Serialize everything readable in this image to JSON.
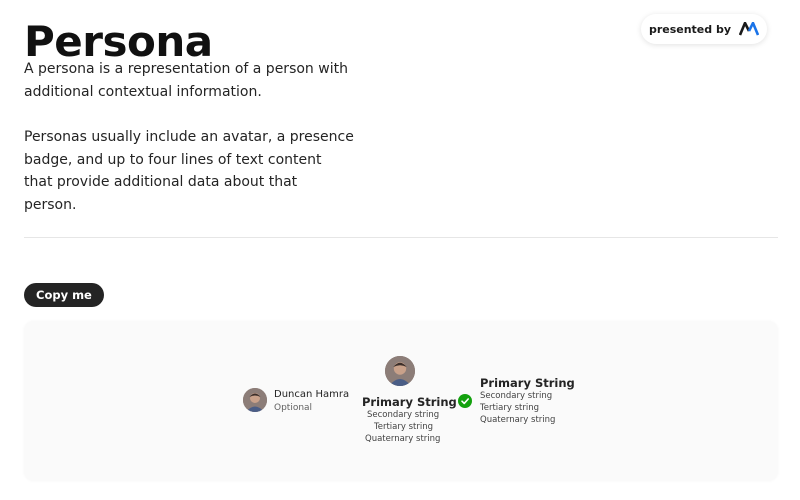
{
  "header": {
    "title": "Persona",
    "presented_by": "presented by",
    "brand_logo_icon": "brand-m-logo-icon",
    "brand_color": "#1a73e8"
  },
  "intro": {
    "paragraph1": "A persona is a representation of a person with additional contextual information.",
    "paragraph2": "Personas usually include an avatar, a presence badge, and up to four lines of text content that provide additional data about that person."
  },
  "copy_button_label": "Copy me",
  "demo": {
    "persona_small": {
      "primary": "Duncan Hamra",
      "secondary": "Optional"
    },
    "persona_stacked": {
      "primary": "Primary String",
      "secondary": "Secondary string",
      "tertiary": "Tertiary string",
      "quaternary": "Quaternary string"
    },
    "persona_presence": {
      "primary": "Primary String",
      "secondary": "Secondary string",
      "tertiary": "Tertiary string",
      "quaternary": "Quaternary string",
      "presence_icon": "available-check-icon",
      "presence_color": "#13a10e"
    }
  }
}
